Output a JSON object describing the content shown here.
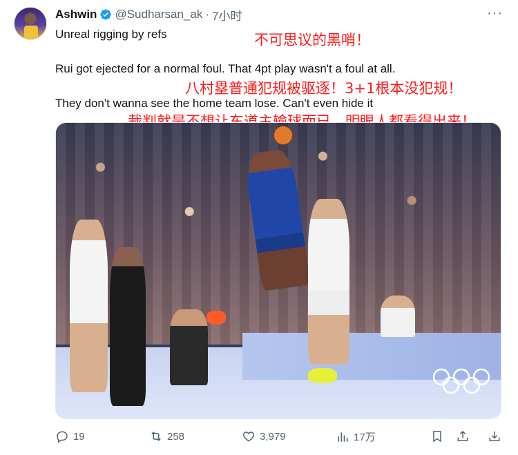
{
  "tweet": {
    "author_name": "Ashwin",
    "author_handle": "@Sudharsan_ak",
    "separator": "·",
    "time": "7小时",
    "more_label": "···",
    "text_line1": "Unreal rigging by refs",
    "text_line2": "Rui got ejected for a normal foul. That 4pt play wasn't a foul at all.",
    "text_line3": "They don't wanna see the home team lose. Can't even hide it"
  },
  "annotations": {
    "line1": "不可思议的黑哨！",
    "line2": "八村塁普通犯规被驱逐！3+1根本没犯规！",
    "line3": "裁判就是不想让东道主输球而已，明眼人都看得出来！"
  },
  "actions": {
    "replies": "19",
    "reposts": "258",
    "likes": "3,979",
    "views": "17万"
  },
  "icons": {
    "verified": "verified-badge-icon",
    "reply": "reply-icon",
    "repost": "repost-icon",
    "like": "heart-icon",
    "views": "views-icon",
    "bookmark": "bookmark-icon",
    "share": "share-icon",
    "download": "download-icon"
  },
  "colors": {
    "annotation_red": "#ff1a1a",
    "verified_blue": "#1d9bf0",
    "muted_text": "#536471"
  }
}
